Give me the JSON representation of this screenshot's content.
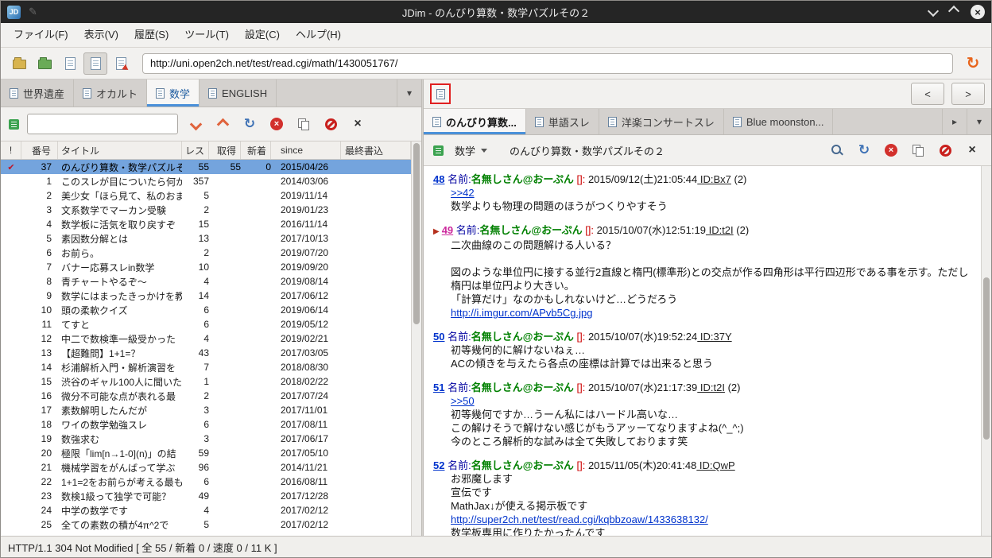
{
  "colors": {
    "link": "#0033cc",
    "visited_link": "#cc2a9d",
    "name_green": "#008000",
    "mail_red": "#cc0000",
    "selection_bg": "#74a4dd",
    "tab_accent": "#4a90d9",
    "titlebar_bg": "#252525",
    "bookmark_red": "#b5301d"
  },
  "icons": {
    "minimize": "chevron-down",
    "maximize": "chevron-up",
    "close": "circle-x",
    "reload": "circular-arrow-orange",
    "refresh": "circular-arrow-blue",
    "stop": "red-circle-x",
    "copy": "overlapping-pages",
    "abone": "no-entry-circle",
    "close_tab": "bold-x",
    "search_down": "chevron-down-orange",
    "search_up": "chevron-up-orange",
    "find": "magnifier",
    "board": "green-board-square",
    "tab_page": "document-page",
    "bookmark": "red-triangle",
    "check": "red-check"
  },
  "window": {
    "title": "JDim - のんびり算数・数学パズルその２"
  },
  "menubar": {
    "items": [
      {
        "key": "file",
        "label": "ファイル(F)"
      },
      {
        "key": "view",
        "label": "表示(V)"
      },
      {
        "key": "history",
        "label": "履歴(S)"
      },
      {
        "key": "tools",
        "label": "ツール(T)"
      },
      {
        "key": "settings",
        "label": "設定(C)"
      },
      {
        "key": "help",
        "label": "ヘルプ(H)"
      }
    ]
  },
  "toolbar": {
    "buttons": [
      {
        "key": "board-list",
        "icon": "folder-yellow",
        "active": false
      },
      {
        "key": "favorites",
        "icon": "folder-green",
        "active": false
      },
      {
        "key": "thread-list",
        "icon": "document",
        "active": false
      },
      {
        "key": "thread-view",
        "icon": "document",
        "active": true
      },
      {
        "key": "image-view",
        "icon": "document-red-arrow",
        "active": false
      }
    ],
    "url": "http://uni.open2ch.net/test/read.cgi/math/1430051767/"
  },
  "board_tabs": {
    "tabs": [
      {
        "key": "world-heritage",
        "label": "世界遺産",
        "active": false
      },
      {
        "key": "occult",
        "label": "オカルト",
        "active": false
      },
      {
        "key": "math",
        "label": "数学",
        "active": true
      },
      {
        "key": "english",
        "label": "ENGLISH",
        "active": false
      }
    ]
  },
  "search": {
    "value": ""
  },
  "thread_list": {
    "columns": [
      "!",
      "番号",
      "タイトル",
      "レス",
      "取得",
      "新着",
      "since",
      "最終書込"
    ],
    "rows": [
      {
        "num": "37",
        "title": "のんびり算数・数学パズルその２",
        "res": "55",
        "got": "55",
        "new": "0",
        "since": "2015/04/26",
        "selected": true,
        "marked": true
      },
      {
        "num": "1",
        "title": "このスレが目についたら何か",
        "res": "357",
        "since": "2014/03/06"
      },
      {
        "num": "2",
        "title": "美少女「ほら見て、私のおま",
        "res": "5",
        "since": "2019/11/14"
      },
      {
        "num": "3",
        "title": "文系数学でマーカン受験",
        "res": "2",
        "since": "2019/01/23"
      },
      {
        "num": "4",
        "title": "数学板に活気を取り戻すぞ",
        "res": "15",
        "since": "2016/11/14"
      },
      {
        "num": "5",
        "title": "素因数分解とは",
        "res": "13",
        "since": "2017/10/13"
      },
      {
        "num": "6",
        "title": "お前ら。",
        "res": "2",
        "since": "2019/07/20"
      },
      {
        "num": "7",
        "title": "バナー応募スレin数学",
        "res": "10",
        "since": "2019/09/20"
      },
      {
        "num": "8",
        "title": "青チャートやるぞ～",
        "res": "4",
        "since": "2019/08/14"
      },
      {
        "num": "9",
        "title": "数学にはまったきっかけを教",
        "res": "14",
        "since": "2017/06/12"
      },
      {
        "num": "10",
        "title": "頭の柔軟クイズ",
        "res": "6",
        "since": "2019/06/14"
      },
      {
        "num": "11",
        "title": "てすと",
        "res": "6",
        "since": "2019/05/12"
      },
      {
        "num": "12",
        "title": "中二で数検準一級受かった",
        "res": "4",
        "since": "2019/02/21"
      },
      {
        "num": "13",
        "title": "【超難問】1+1=？",
        "res": "43",
        "since": "2017/03/05"
      },
      {
        "num": "14",
        "title": "杉浦解析入門・解析演習を",
        "res": "7",
        "since": "2018/08/30"
      },
      {
        "num": "15",
        "title": "渋谷のギャル100人に聞いた",
        "res": "1",
        "since": "2018/02/22"
      },
      {
        "num": "16",
        "title": "微分不可能な点が表れる最",
        "res": "2",
        "since": "2017/07/24"
      },
      {
        "num": "17",
        "title": "素数解明したんだが",
        "res": "3",
        "since": "2017/11/01"
      },
      {
        "num": "18",
        "title": "ワイの数学勉強スレ",
        "res": "6",
        "since": "2017/08/11"
      },
      {
        "num": "19",
        "title": "数強求む",
        "res": "3",
        "since": "2017/06/17"
      },
      {
        "num": "20",
        "title": "極限「lim[n→1-0](n)」の結",
        "res": "59",
        "since": "2017/05/10"
      },
      {
        "num": "21",
        "title": "機械学習をがんばって学ぶ",
        "res": "96",
        "since": "2014/11/21"
      },
      {
        "num": "22",
        "title": "1+1=2をお前らが考える最も",
        "res": "6",
        "since": "2016/08/11"
      },
      {
        "num": "23",
        "title": "数検1級って独学で可能？",
        "res": "49",
        "since": "2017/12/28"
      },
      {
        "num": "24",
        "title": "中学の数学です",
        "res": "4",
        "since": "2017/02/12"
      },
      {
        "num": "25",
        "title": "全ての素数の積が4π^2で",
        "res": "5",
        "since": "2017/02/12"
      }
    ]
  },
  "right_top": {
    "back": "<",
    "forward": ">"
  },
  "thread_tabs": {
    "tabs": [
      {
        "key": "nonbiri-sansu",
        "label": "のんびり算数...",
        "active": true
      },
      {
        "key": "tango-thread",
        "label": "単語スレ",
        "active": false
      },
      {
        "key": "yogaku-concert",
        "label": "洋楽コンサートスレ",
        "active": false
      },
      {
        "key": "blue-moonstone",
        "label": "Blue moonston...",
        "active": false
      }
    ]
  },
  "thread_view": {
    "board_select": "数学",
    "title": "のんびり算数・数学パズルその２",
    "name_label": "名前:",
    "posts": [
      {
        "num": "48",
        "visited": false,
        "bookmark": false,
        "name": "名無しさん@おーぷん",
        "mail": "[]:",
        "date": "2015/09/12(土)21:05:44",
        "id": "ID:Bx7",
        "count": "(2)",
        "lines": [
          {
            "t": "link",
            "text": ">>42"
          },
          {
            "t": "text",
            "text": "数学よりも物理の問題のほうがつくりやすそう"
          }
        ]
      },
      {
        "num": "49",
        "visited": true,
        "bookmark": true,
        "name": "名無しさん@おーぷん",
        "mail": "[]:",
        "date": "2015/10/07(水)12:51:19",
        "id": "ID:t2I",
        "count": "(2)",
        "lines": [
          {
            "t": "text",
            "text": "二次曲線のこの問題解ける人いる？"
          },
          {
            "t": "blank",
            "text": ""
          },
          {
            "t": "text",
            "text": "図のような単位円に接する並行2直線と楕円(標準形)との交点が作る四角形は平行四辺形である事を示す。ただし楕円は単位円より大きい。"
          },
          {
            "t": "text",
            "text": "「計算だけ」なのかもしれないけど…どうだろう"
          },
          {
            "t": "link",
            "text": "http://i.imgur.com/APvb5Cg.jpg"
          }
        ]
      },
      {
        "num": "50",
        "visited": false,
        "bookmark": false,
        "name": "名無しさん@おーぷん",
        "mail": "[]:",
        "date": "2015/10/07(水)19:52:24",
        "id": "ID:37Y",
        "count": "",
        "lines": [
          {
            "t": "text",
            "text": "初等幾何的に解けないねぇ…"
          },
          {
            "t": "text",
            "text": "ACの傾きを与えたら各点の座標は計算では出来ると思う"
          }
        ]
      },
      {
        "num": "51",
        "visited": false,
        "bookmark": false,
        "name": "名無しさん@おーぷん",
        "mail": "[]:",
        "date": "2015/10/07(水)21:17:39",
        "id": "ID:t2I",
        "count": "(2)",
        "lines": [
          {
            "t": "link",
            "text": ">>50"
          },
          {
            "t": "text",
            "text": "初等幾何ですか…うーん私にはハードル高いな…"
          },
          {
            "t": "text",
            "text": "この解けそうで解けない感じがもうアッーてなりますよね(^_^;)"
          },
          {
            "t": "text",
            "text": "今のところ解析的な試みは全て失敗しております笑"
          }
        ]
      },
      {
        "num": "52",
        "visited": false,
        "bookmark": false,
        "name": "名無しさん@おーぷん",
        "mail": "[]:",
        "date": "2015/11/05(木)20:41:48",
        "id": "ID:QwP",
        "count": "",
        "lines": [
          {
            "t": "text",
            "text": "お邪魔します"
          },
          {
            "t": "text",
            "text": "宣伝です"
          },
          {
            "t": "text",
            "text": "MathJax↓が使える掲示板です"
          },
          {
            "t": "link",
            "text": "http://super2ch.net/test/read.cgi/kqbbzoaw/1433638132/"
          },
          {
            "t": "text",
            "text": "数学板専用に作りたかったんです"
          }
        ]
      }
    ]
  },
  "statusbar": {
    "text": "HTTP/1.1 304 Not Modified [ 全 55 / 新着 0 / 速度 0 / 11 K ]"
  }
}
